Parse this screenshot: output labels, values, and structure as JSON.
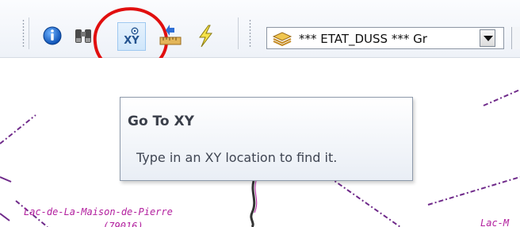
{
  "toolbar": {
    "icons": [
      "info-icon",
      "binoculars-icon",
      "go-to-xy-icon",
      "measure-icon",
      "flash-icon"
    ],
    "xy_button_label": "XY",
    "highlight_color": "#e10f0f",
    "layer_dropdown": {
      "selected": "*** ETAT_DUSS *** Gr",
      "icon": "layers-icon"
    }
  },
  "tooltip": {
    "title": "Go To XY",
    "description": "Type in an XY location to find it."
  },
  "map": {
    "labels": [
      {
        "text": "Lac-de-La-Maison-de-Pierre"
      },
      {
        "text": "(79016)"
      },
      {
        "text": "Lac-M"
      }
    ],
    "label_color": "#b21f9e"
  }
}
